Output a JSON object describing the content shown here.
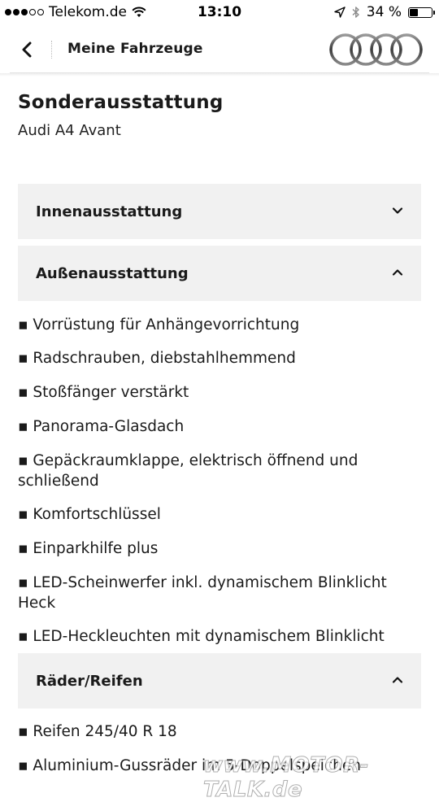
{
  "status_bar": {
    "carrier": "Telekom.de",
    "signal_bars": 3,
    "time": "13:10",
    "battery_percent_label": "34 %",
    "battery_level": 0.34,
    "icons": [
      "wifi-icon",
      "location-arrow-icon",
      "bluetooth-icon",
      "battery-icon"
    ]
  },
  "nav": {
    "back_icon": "chevron-left-icon",
    "title": "Meine Fahrzeuge",
    "logo": "audi-rings-logo"
  },
  "page": {
    "title": "Sonderausstattung",
    "subtitle": "Audi A4 Avant"
  },
  "sections": [
    {
      "label": "Innenausstattung",
      "expanded": false,
      "icon": "chevron-down-icon"
    },
    {
      "label": "Außenausstattung",
      "expanded": true,
      "icon": "chevron-up-icon",
      "items": [
        "▪ Vorrüstung für Anhängevorrichtung",
        "▪ Radschrauben, diebstahlhemmend",
        "▪ Stoßfänger verstärkt",
        "▪ Panorama-Glasdach",
        "▪ Gepäckraumklappe, elektrisch öffnend und schließend",
        "▪ Komfortschlüssel",
        "▪ Einparkhilfe plus",
        "▪ LED-Scheinwerfer inkl. dynamischem Blinklicht Heck",
        "▪ LED-Heckleuchten mit dynamischem Blinklicht"
      ]
    },
    {
      "label": "Räder/Reifen",
      "expanded": true,
      "icon": "chevron-up-icon",
      "items": [
        "▪ Reifen 245/40 R 18",
        "▪ Aluminium-Gussräder im 5-Doppelspeichen-"
      ]
    }
  ],
  "watermark": "www.MOTOR-TALK.de",
  "colors": {
    "section_bg": "#f1f1f1",
    "text": "#1a1a1a",
    "background": "#ffffff"
  }
}
